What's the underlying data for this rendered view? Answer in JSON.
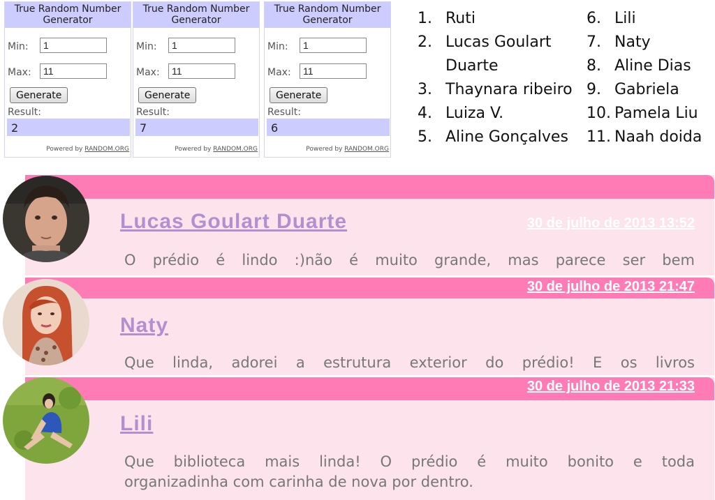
{
  "rng": {
    "widgets": [
      {
        "title": "True Random Number Generator",
        "min_label": "Min:",
        "min": "1",
        "max_label": "Max:",
        "max": "11",
        "button": "Generate",
        "result_label": "Result:",
        "result": "2",
        "powered": "Powered by",
        "powered_link": "RANDOM.ORG"
      },
      {
        "title": "True Random Number Generator",
        "min_label": "Min:",
        "min": "1",
        "max_label": "Max:",
        "max": "11",
        "button": "Generate",
        "result_label": "Result:",
        "result": "7",
        "powered": "Powered by",
        "powered_link": "RANDOM.ORG"
      },
      {
        "title": "True Random Number Generator",
        "min_label": "Min:",
        "min": "1",
        "max_label": "Max:",
        "max": "11",
        "button": "Generate",
        "result_label": "Result:",
        "result": "6",
        "powered": "Powered by",
        "powered_link": "RANDOM.ORG"
      }
    ]
  },
  "names": {
    "col1": [
      {
        "num": "1.",
        "name": "Ruti"
      },
      {
        "num": "2.",
        "name": "Lucas Goulart"
      },
      {
        "num": "",
        "name": "Duarte"
      },
      {
        "num": "3.",
        "name": "Thaynara ribeiro"
      },
      {
        "num": "4.",
        "name": "Luiza V."
      },
      {
        "num": "5.",
        "name": "Aline Gonçalves"
      }
    ],
    "col2": [
      {
        "num": "6.",
        "name": "Lili"
      },
      {
        "num": "7.",
        "name": "Naty"
      },
      {
        "num": "8.",
        "name": "Aline Dias"
      },
      {
        "num": "9.",
        "name": "Gabriela"
      },
      {
        "num": "10.",
        "name": "Pamela Liu"
      },
      {
        "num": "11.",
        "name": "Naah doida"
      }
    ]
  },
  "comments": [
    {
      "author": "Lucas Goulart Duarte",
      "date": "30 de julho de 2013 13:52",
      "text": "O prédio é lindo :)não é muito grande, mas parece ser bem"
    },
    {
      "author": "Naty",
      "date": "30 de julho de 2013 21:47",
      "text": "Que linda, adorei a estrutura exterior do prédio! E os livros"
    },
    {
      "author": "Lili",
      "date": "30 de julho de 2013 21:33",
      "text1": "Que biblioteca mais linda! O prédio é muito bonito e toda",
      "text2": "organizadinha com carinha de nova por dentro."
    }
  ],
  "colors": {
    "bar": "#ff7bb5",
    "comment_bg": "#fde3ec",
    "author": "#b48fd0",
    "rng_accent": "#ccccff"
  }
}
